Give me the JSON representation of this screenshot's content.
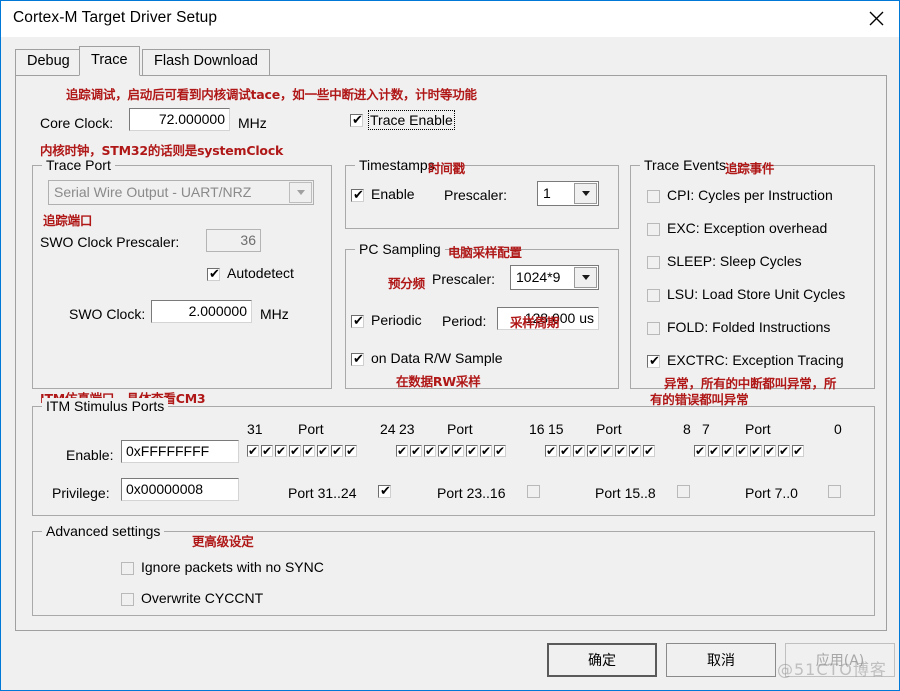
{
  "window": {
    "title": "Cortex-M Target Driver Setup",
    "close_icon": "close-icon",
    "accent_color": "#0078d7"
  },
  "tabs": [
    {
      "label": "Debug",
      "active": false
    },
    {
      "label": "Trace",
      "active": true
    },
    {
      "label": "Flash Download",
      "active": false
    }
  ],
  "annotations": {
    "color": "#b01818",
    "header": "追踪调试，启动后可看到内核调试tace，如一些中断进入计数，计时等功能",
    "core_clock": "内核时钟，STM32的话则是systemClock",
    "trace_port": "追踪端口",
    "timestamps": "时间戳",
    "pc_sampling": "电脑采样配置",
    "prescaler": "预分频",
    "period": "采样周期",
    "on_data_rw": "在数据RW采样",
    "trace_events": "追踪事件",
    "exctrc_line1": "异常，所有的中断都叫异常，所",
    "exctrc_line2": "有的错误都叫异常",
    "itm": "ITM仿真端口，具体查看CM3",
    "advanced": "更高级设定"
  },
  "core_clock": {
    "label": "Core Clock:",
    "value": "72.000000",
    "unit": "MHz"
  },
  "trace_enable": {
    "label": "Trace Enable",
    "checked": true,
    "focused": true
  },
  "trace_port": {
    "title": "Trace Port",
    "protocol": {
      "value": "Serial Wire Output - UART/NRZ",
      "disabled": true
    },
    "swo_prescaler": {
      "label": "SWO Clock Prescaler:",
      "value": "36",
      "disabled": true
    },
    "autodetect": {
      "label": "Autodetect",
      "checked": true
    },
    "swo_clock": {
      "label": "SWO Clock:",
      "value": "2.000000",
      "unit": "MHz"
    }
  },
  "timestamps": {
    "title": "Timestamps",
    "enable": {
      "label": "Enable",
      "checked": true
    },
    "prescaler": {
      "label": "Prescaler:",
      "value": "1"
    }
  },
  "pc_sampling": {
    "title": "PC Sampling",
    "prescaler": {
      "label": "Prescaler:",
      "value": "1024*9"
    },
    "periodic": {
      "label": "Periodic",
      "checked": true
    },
    "period": {
      "label": "Period:",
      "value": "128.000 us"
    },
    "on_data_rw": {
      "label": "on Data R/W Sample",
      "checked": true
    }
  },
  "trace_events": {
    "title": "Trace Events",
    "items": [
      {
        "label": "CPI: Cycles per Instruction",
        "checked": false
      },
      {
        "label": "EXC: Exception overhead",
        "checked": false
      },
      {
        "label": "SLEEP: Sleep Cycles",
        "checked": false
      },
      {
        "label": "LSU: Load Store Unit Cycles",
        "checked": false
      },
      {
        "label": "FOLD: Folded Instructions",
        "checked": false
      },
      {
        "label": "EXCTRC: Exception Tracing",
        "checked": true
      }
    ]
  },
  "itm": {
    "title": "ITM Stimulus Ports",
    "enable": {
      "label": "Enable:",
      "value": "0xFFFFFFFF"
    },
    "privilege": {
      "label": "Privilege:",
      "value": "0x00000008"
    },
    "port_word": "Port",
    "ranges": [
      {
        "high": "31",
        "low": "24",
        "group_label": "Port 31..24",
        "group_checked": true,
        "bits": [
          true,
          true,
          true,
          true,
          true,
          true,
          true,
          true
        ]
      },
      {
        "high": "23",
        "low": "16",
        "group_label": "Port 23..16",
        "group_checked": false,
        "bits": [
          true,
          true,
          true,
          true,
          true,
          true,
          true,
          true
        ]
      },
      {
        "high": "15",
        "low": "8",
        "group_label": "Port 15..8",
        "group_checked": false,
        "bits": [
          true,
          true,
          true,
          true,
          true,
          true,
          true,
          true
        ]
      },
      {
        "high": "7",
        "low": "0",
        "group_label": "Port 7..0",
        "group_checked": false,
        "bits": [
          true,
          true,
          true,
          true,
          true,
          true,
          true,
          true
        ]
      }
    ]
  },
  "advanced": {
    "title": "Advanced settings",
    "items": [
      {
        "label": "Ignore packets with no SYNC",
        "checked": false
      },
      {
        "label": "Overwrite CYCCNT",
        "checked": false
      }
    ]
  },
  "buttons": {
    "ok": "确定",
    "cancel": "取消",
    "apply": "应用(A)",
    "apply_disabled": true
  },
  "watermark": "@51CTO博客"
}
